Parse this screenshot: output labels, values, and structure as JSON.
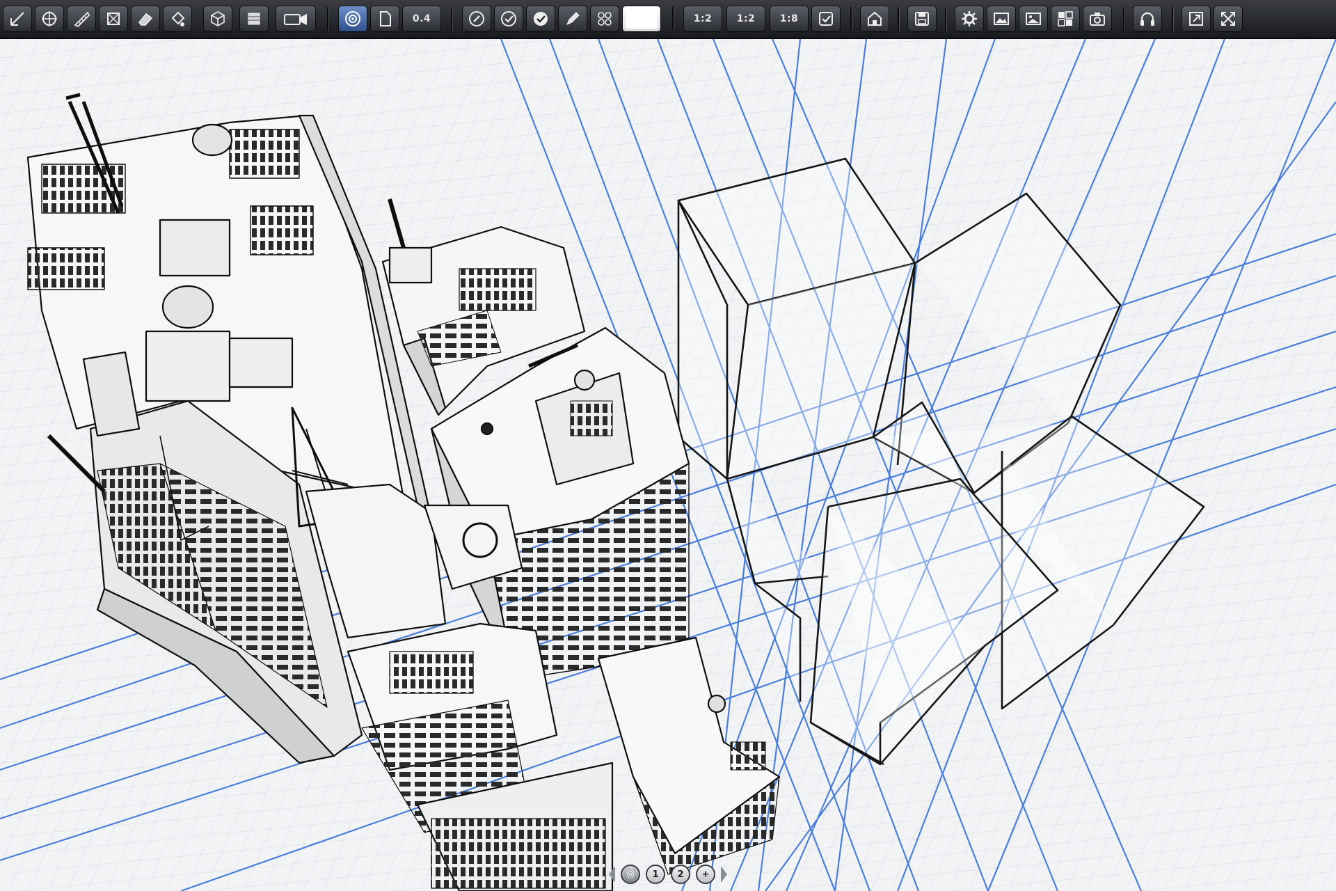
{
  "toolbar": {
    "buttons": [
      {
        "id": "line-tool",
        "icon": "line-tool-icon"
      },
      {
        "id": "target-tool",
        "icon": "target-icon"
      },
      {
        "id": "ruler-tool",
        "icon": "ruler-icon"
      },
      {
        "id": "transform-tool",
        "icon": "transform-icon"
      },
      {
        "id": "eraser-tool",
        "icon": "eraser-icon"
      },
      {
        "id": "fill-tool",
        "icon": "fill-icon"
      },
      {
        "id": "cube-tool",
        "icon": "cube-icon"
      },
      {
        "id": "layers-tool",
        "icon": "layers-icon"
      },
      {
        "id": "camera-tool",
        "icon": "video-camera-icon"
      },
      {
        "id": "perspective-tool",
        "icon": "circle-target-icon",
        "active": true
      },
      {
        "id": "page-tool",
        "icon": "page-icon"
      },
      {
        "id": "line-weight",
        "label": "0.4"
      },
      {
        "id": "brush-tool",
        "icon": "brush-circle-icon"
      },
      {
        "id": "check-tool-1",
        "icon": "check-circle-icon"
      },
      {
        "id": "check-tool-2",
        "icon": "check-circle-icon"
      },
      {
        "id": "pen-tool",
        "icon": "pen-icon"
      },
      {
        "id": "grid-tool",
        "icon": "grid-icon"
      },
      {
        "id": "color-swatch",
        "icon": "white-swatch",
        "color": "#ffffff"
      },
      {
        "id": "ratio-1",
        "label": "1:2"
      },
      {
        "id": "ratio-2",
        "label": "1:2"
      },
      {
        "id": "ratio-3",
        "label": "1:8"
      },
      {
        "id": "confirm-tool",
        "icon": "check-box-icon"
      },
      {
        "id": "house-tool",
        "icon": "house-icon"
      },
      {
        "id": "save-tool",
        "icon": "disk-icon"
      },
      {
        "id": "settings-tool",
        "icon": "gear-icon"
      },
      {
        "id": "image-tool-1",
        "icon": "image-icon"
      },
      {
        "id": "image-tool-2",
        "icon": "image-icon"
      },
      {
        "id": "gallery-tool",
        "icon": "gallery-icon"
      },
      {
        "id": "snapshot-tool",
        "icon": "camera-icon"
      },
      {
        "id": "audio-tool",
        "icon": "headphones-icon"
      },
      {
        "id": "export-tool",
        "icon": "export-icon"
      },
      {
        "id": "fullscreen-tool",
        "icon": "fullscreen-icon"
      }
    ]
  },
  "colors": {
    "guide_line": "#3a72d8",
    "grid_line": "#c9ced6",
    "ink": "#111111",
    "paper": "#f2f3f4"
  },
  "page_nav": {
    "pages": [
      {
        "icon": "home-icon"
      },
      {
        "label": "1"
      },
      {
        "label": "2"
      },
      {
        "icon": "add-icon"
      }
    ],
    "active_index": 0
  }
}
